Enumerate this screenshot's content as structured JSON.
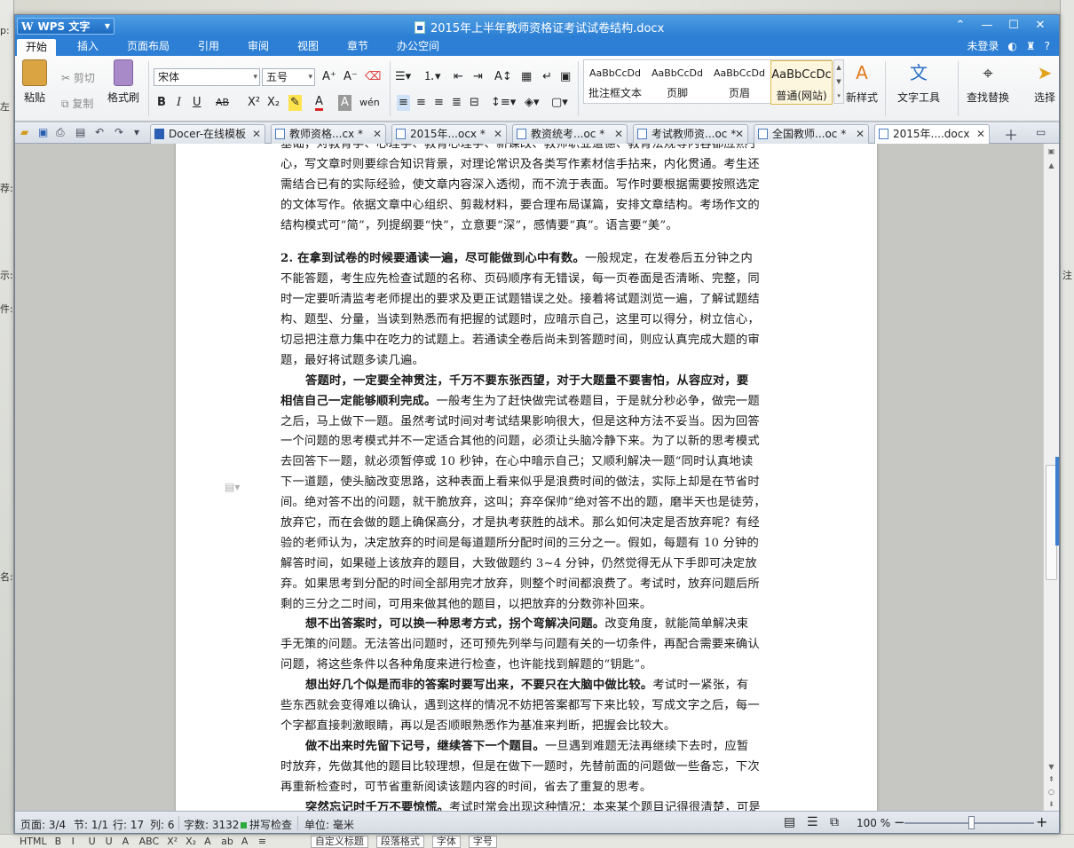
{
  "background": {
    "left_fragments": [
      "p:",
      "左",
      "荐:",
      "示:",
      "件:",
      "名:"
    ],
    "right_fragments": [
      "注"
    ],
    "bottom_toolbar": {
      "label_html": "HTML",
      "glyphs": [
        "B",
        "I",
        "U",
        "U",
        "A",
        "ABC",
        "X²",
        "X₂",
        "A",
        "ab",
        "A",
        "≡"
      ],
      "dropdowns": [
        "自定义标题",
        "段落格式",
        "字体",
        "字号"
      ]
    }
  },
  "window": {
    "app_name": "WPS 文字",
    "title": "2015年上半年教师资格证考试试卷结构.docx",
    "controls": {
      "collapse": "⌃",
      "minimize": "—",
      "maximize": "☐",
      "close": "✕"
    }
  },
  "menu": {
    "items": [
      "开始",
      "插入",
      "页面布局",
      "引用",
      "审阅",
      "视图",
      "章节",
      "办公空间"
    ],
    "active": "开始",
    "right": {
      "login": "未登录",
      "help": "?"
    }
  },
  "ribbon": {
    "paste": "粘贴",
    "cut": "剪切",
    "copy": "复制",
    "format_painter": "格式刷",
    "font_name": "宋体",
    "font_size": "五号",
    "styles": [
      {
        "preview": "AaBbCcDd",
        "name": "批注框文本"
      },
      {
        "preview": "AaBbCcDd",
        "name": "页脚"
      },
      {
        "preview": "AaBbCcDd",
        "name": "页眉"
      },
      {
        "preview": "AaBbCcDc",
        "name": "普通(网站)"
      }
    ],
    "new_style": "新样式",
    "text_tools": "文字工具",
    "find_replace": "查找替换",
    "select": "选择"
  },
  "tabs": [
    {
      "label": "Docer-在线模板",
      "active": false
    },
    {
      "label": "教师资格...cx *",
      "active": false
    },
    {
      "label": "2015年...ocx *",
      "active": false
    },
    {
      "label": "教资统考...oc *",
      "active": false
    },
    {
      "label": "考试教师资...oc *",
      "active": false
    },
    {
      "label": "全国教师...oc *",
      "active": false
    },
    {
      "label": "2015年....docx",
      "active": true
    }
  ],
  "document": {
    "lines": [
      "基础，对教育学、心理学、教育心理学、新课改、教师职业道德、教育法规等内容都应熟于",
      "心，写文章时则要综合知识背景，对理论常识及各类写作素材信手拈来，内化贯通。考生还",
      "需结合已有的实际经验，使文章内容深入透彻，而不流于表面。写作时要根据需要按照选定",
      "的文体写作。依据文章中心组织、剪裁材料，要合理布局谋篇，安排文章结构。考场作文的",
      "结构模式可“简”，列提纲要“快”，立意要“深”，感情要“真”。语言要“美”。"
    ],
    "p2_bold": "2. 在拿到试卷的时候要通读一遍，尽可能做到心中有数。",
    "p2_first_rest": "一般规定，在发卷后五分钟之内",
    "p2_lines": [
      "不能答题，考生应先检查试题的名称、页码顺序有无错误，每一页卷面是否清晰、完整，同",
      "时一定要听清监考老师提出的要求及更正试题错误之处。接着将试题浏览一遍，了解试题结",
      "构、题型、分量，当读到熟悉而有把握的试题时，应暗示自己，这里可以得分，树立信心，",
      "切忌把注意力集中在吃力的试题上。若通读全卷后尚未到答题时间，则应认真完成大题的审",
      "题，最好将试题多读几遍。"
    ],
    "p3_bold_1": "答题时，一定要全神贯注，千万不要东张西望，对于大题量不要害怕，从容应对，要",
    "p3_bold_2": "相信自己一定能够顺利完成。",
    "p3_rest_2": "一般考生为了赶快做完试卷题目，于是就分秒必争，做完一题",
    "p3_lines": [
      "之后，马上做下一题。虽然考试时间对考试结果影响很大，但是这种方法不妥当。因为回答",
      "一个问题的思考模式并不一定适合其他的问题，必须让头脑冷静下来。为了以新的思考模式",
      "去回答下一题，就必须暂停或 10 秒钟，在心中暗示自己；又顺利解决一题“同时认真地读",
      "下一道题，使头脑改变思路，这种表面上看来似乎是浪费时间的做法，实际上却是在节省时",
      "间。绝对答不出的问题，就干脆放弃，这叫；弃卒保帅”绝对答不出的题，磨半天也是徒劳，",
      "放弃它，而在会做的题上确保高分，才是执考获胜的战术。那么如何决定是否放弃呢？有经",
      "验的老师认为，决定放弃的时间是每道题所分配时间的三分之一。假如，每题有 10 分钟的",
      "解答时间，如果碰上该放弃的题目，大致做题约 3~4 分钟，仍然觉得无从下手即可决定放",
      "弃。如果思考到分配的时间全部用完才放弃，则整个时间都浪费了。考试时，放弃问题后所",
      "剩的三分之二时间，可用来做其他的题目，以把放弃的分数弥补回来。"
    ],
    "p4_bold": "想不出答案时，可以换一种思考方式，拐个弯解决问题。",
    "p4_rest": "改变角度，就能简单解决束",
    "p4_lines": [
      "手无策的问题。无法答出问题时，还可预先列举与问题有关的一切条件，再配合需要来确认",
      "问题，将这些条件以各种角度来进行检查，也许能找到解题的“钥匙”。"
    ],
    "p5_bold": "想出好几个似是而非的答案时要写出来，不要只在大脑中做比较。",
    "p5_rest": "考试时一紧张，有",
    "p5_lines": [
      "些东西就会变得难以确认，遇到这样的情况不妨把答案都写下来比较，写成文字之后，每一",
      "个字都直接刺激眼睛，再以是否顺眼熟悉作为基准来判断，把握会比较大。"
    ],
    "p6_bold": "做不出来时先留下记号，继续答下一个题目。",
    "p6_rest": "一旦遇到难题无法再继续下去时，应暂",
    "p6_lines": [
      "时放弃，先做其他的题目比较理想，但是在做下一题时，先替前面的问题做一些备忘，下次",
      "再重新检查时，可节省重新阅读该题内容的时间，省去了重复的思考。"
    ],
    "p7_bold": "突然忘记时千万不要惊慌。",
    "p7_rest": "考试时常会出现这种情况：本来某个题目记得很清楚，可是"
  },
  "status": {
    "page": "页面: 3/4",
    "section": "节: 1/1",
    "row": "行: 17",
    "col": "列: 6",
    "words": "字数: 3132",
    "spell": "拼写检查",
    "unit": "单位: 毫米",
    "zoom": "100 %",
    "zoom_level_percent": 100
  }
}
